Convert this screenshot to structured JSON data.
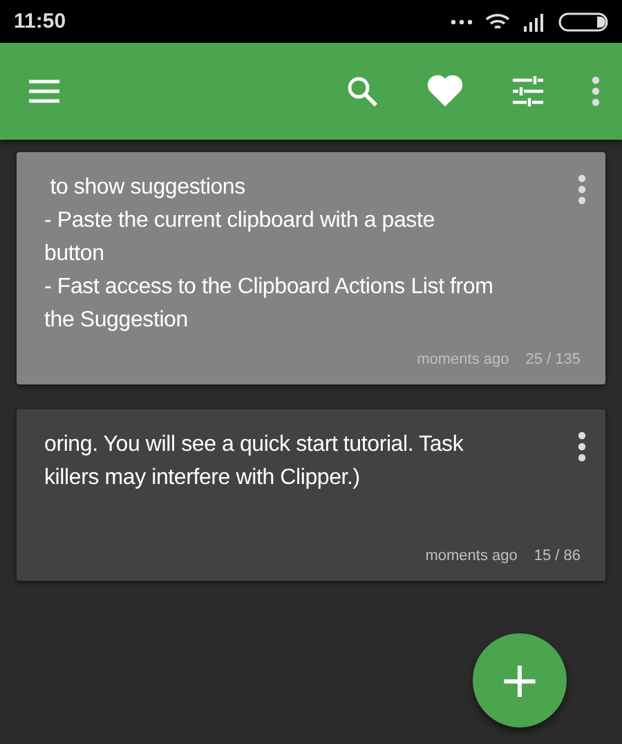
{
  "status_bar": {
    "time": "11:50"
  },
  "notes": [
    {
      "selected": true,
      "lines": [
        " to show suggestions",
        "- Paste the current clipboard with a paste",
        "button",
        "- Fast access to the Clipboard Actions List from",
        "the Suggestion"
      ],
      "time": "moments ago",
      "count": "25 / 135"
    },
    {
      "selected": false,
      "lines": [
        "oring. You will see a quick start tutorial. Task",
        "killers may interfere with Clipper.)"
      ],
      "time": "moments ago",
      "count": "15 / 86"
    }
  ],
  "fab": "+"
}
